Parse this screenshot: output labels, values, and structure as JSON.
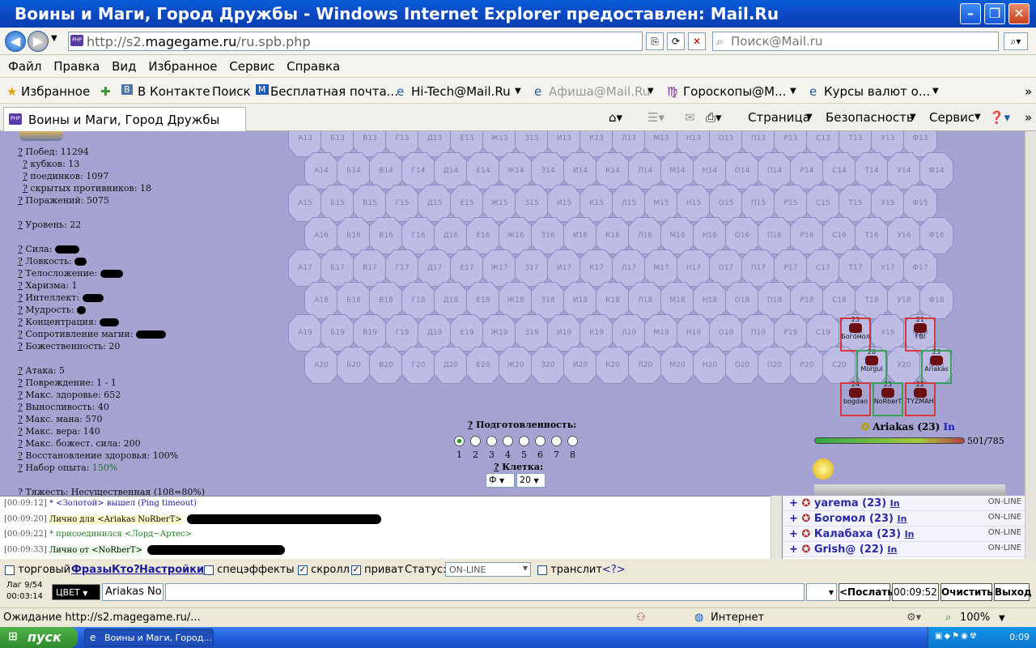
{
  "window": {
    "title": "Воины и Маги, Город Дружбы - Windows Internet Explorer предоставлен: Mail.Ru"
  },
  "address": {
    "prefix": "http://s2.",
    "domain": "magegame.ru",
    "path": "/ru.spb.php",
    "search_placeholder": "Поиск@Mail.ru"
  },
  "menu": [
    "Файл",
    "Правка",
    "Вид",
    "Избранное",
    "Сервис",
    "Справка"
  ],
  "favorites": {
    "label": "Избранное",
    "items": [
      "В Контакте",
      "Поиск",
      "Бесплатная почта...",
      "Hi-Tech@Mail.Ru",
      "Афиша@Mail.Ru",
      "Гороскопы@М...",
      "Курсы валют о..."
    ]
  },
  "tab": {
    "title": "Воины и Маги, Город Дружбы"
  },
  "tab_tools": [
    "Страница",
    "Безопасность",
    "Сервис"
  ],
  "stats": [
    {
      "l": "Побед: 11294"
    },
    {
      "l": "кубков: 13",
      "indent": true
    },
    {
      "l": "поединков: 1097",
      "indent": true
    },
    {
      "l": "скрытых противников: 18",
      "indent": true
    },
    {
      "l": "Поражений: 5075"
    },
    {
      "l": ""
    },
    {
      "l": "Уровень: 22"
    },
    {
      "l": ""
    },
    {
      "l": "Сила:",
      "blot": true
    },
    {
      "l": "Ловкость:",
      "blot": true
    },
    {
      "l": "Телосложение:",
      "blot": true
    },
    {
      "l": "Харизма: 1"
    },
    {
      "l": "Интеллект:",
      "blot": true
    },
    {
      "l": "Мудрость:",
      "blot": true
    },
    {
      "l": "Концентрация:",
      "blot": true
    },
    {
      "l": "Сопротивление магии:",
      "blot": true
    },
    {
      "l": "Божественность: 20"
    },
    {
      "l": ""
    },
    {
      "l": "Атака: 5"
    },
    {
      "l": "Повреждение: 1 - 1"
    },
    {
      "l": "Макс. здоровье: 652"
    },
    {
      "l": "Выносливость: 40"
    },
    {
      "l": "Макс. мана: 570"
    },
    {
      "l": "Макс. вера: 140"
    },
    {
      "l": "Макс. божест. сила: 200"
    },
    {
      "l": "Восстановление здоровья: 100%"
    },
    {
      "l": "Набор опыта:",
      "v": "150%"
    },
    {
      "l": ""
    },
    {
      "l": "Тяжесть: Несущественная (108=80%)"
    }
  ],
  "grid": {
    "cols": [
      "А",
      "Б",
      "В",
      "Г",
      "Д",
      "Е",
      "Ж",
      "З",
      "И",
      "К",
      "Л",
      "М",
      "Н",
      "О",
      "П",
      "Р",
      "С",
      "Т",
      "У",
      "Ф"
    ],
    "rows": [
      "13",
      "14",
      "15",
      "16",
      "17",
      "18",
      "19",
      "20"
    ]
  },
  "units": [
    {
      "lvl": "23",
      "name": "Богомол",
      "c": 17,
      "r": 6,
      "b": "red"
    },
    {
      "lvl": "21",
      "name": "FBI",
      "c": 19,
      "r": 6,
      "b": "red"
    },
    {
      "lvl": "20",
      "name": "Morgul",
      "c": 17,
      "r": 7,
      "b": "grn"
    },
    {
      "lvl": "23",
      "name": "Ariakas",
      "c": 19,
      "r": 7,
      "b": "grn"
    },
    {
      "lvl": "24",
      "name": "bogdan",
      "c": 17,
      "r": 8,
      "b": "red"
    },
    {
      "lvl": "23",
      "name": "NoRberT",
      "c": 18,
      "r": 8,
      "b": "grn"
    },
    {
      "lvl": "22",
      "name": "TYZMAH",
      "c": 19,
      "r": 8,
      "b": "red"
    }
  ],
  "prep": {
    "label": "Подготовленность:",
    "options": [
      "1",
      "2",
      "3",
      "4",
      "5",
      "6",
      "7",
      "8"
    ],
    "selected": 0
  },
  "cell": {
    "label": "Клетка:",
    "col": "Ф",
    "row": "20"
  },
  "player": {
    "name": "Ariakas (23)",
    "status": "In",
    "hp": "501/785",
    "hp_fraction": 0.64
  },
  "chat": [
    {
      "t": "[00:09:12]",
      "msg": "* <Золотой> вышел (Ping timeout)",
      "kind": "sys"
    },
    {
      "t": "[00:09:20]",
      "msg": "Лично для <Ariakas NoRberT>",
      "kind": "priv"
    },
    {
      "t": "[00:09:22]",
      "msg": "* присоединился <Лорд~Артес>",
      "kind": "join"
    },
    {
      "t": "[00:09:33]",
      "msg": "Лично от <NoRberT>",
      "kind": "privto"
    }
  ],
  "users": [
    {
      "name": "yarema (23)",
      "in": "In",
      "st": "ON-LINE"
    },
    {
      "name": "Богомол (23)",
      "in": "In",
      "st": "ON-LINE"
    },
    {
      "name": "Калабаха (23)",
      "in": "In",
      "st": "ON-LINE"
    },
    {
      "name": "Grish@ (22)",
      "in": "In",
      "st": "ON-LINE"
    }
  ],
  "controls": {
    "trade": "торговый",
    "phrases": "Фразы",
    "who": "Кто?",
    "settings": "Настройки",
    "effects": "спецэффекты",
    "scroll": "скролл",
    "priv": "приват",
    "status_label": "Статус:",
    "status_value": "ON-LINE",
    "translit": "транслит",
    "translit_help": "<?>"
  },
  "input": {
    "lag": "Лаг 9/54",
    "timer": "00:03:14",
    "color": "ЦВЕТ",
    "to": "Ariakas No",
    "send": "<Послать",
    "time": "00:09:52",
    "clear": "Очистить",
    "exit": "Выход"
  },
  "statusbar": {
    "text": "Ожидание http://s2.magegame.ru/...",
    "zone": "Интернет",
    "zoom": "100%"
  },
  "taskbar": {
    "start": "пуск",
    "task": "Воины и Маги, Город...",
    "clock": "0:09"
  }
}
